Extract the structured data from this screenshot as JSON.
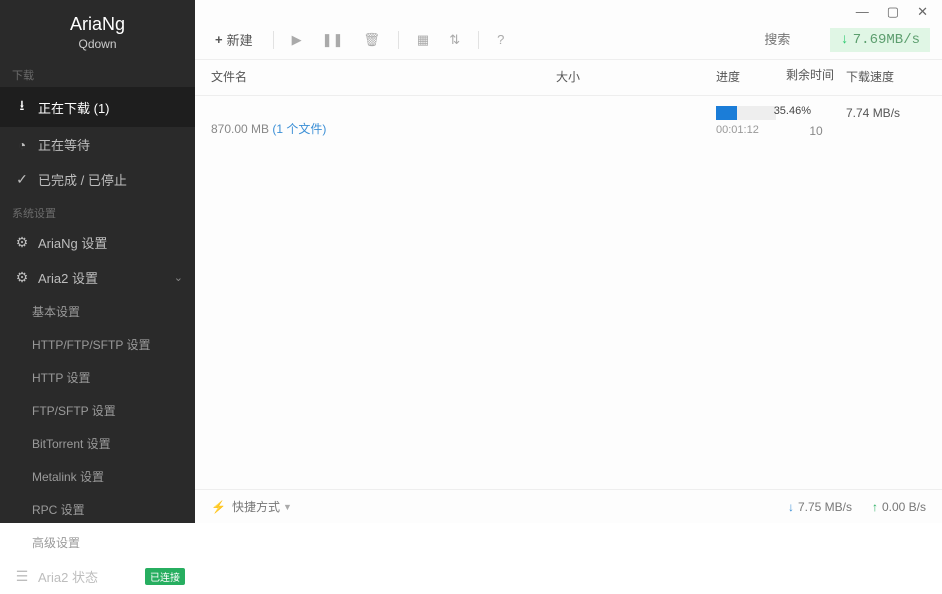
{
  "brand": {
    "title": "AriaNg",
    "subtitle": "Qdown"
  },
  "sidebar": {
    "section_downloads": "下载",
    "downloading": {
      "label": "正在下载 (1)"
    },
    "waiting": {
      "label": "正在等待"
    },
    "finished": {
      "label": "已完成 / 已停止"
    },
    "section_system": "系统设置",
    "ariang_settings": {
      "label": "AriaNg 设置"
    },
    "aria2_settings": {
      "label": "Aria2 设置"
    },
    "aria2_subs": {
      "basic": "基本设置",
      "http_ftp_sftp": "HTTP/FTP/SFTP 设置",
      "http": "HTTP 设置",
      "ftp_sftp": "FTP/SFTP 设置",
      "bittorrent": "BitTorrent 设置",
      "metalink": "Metalink 设置",
      "rpc": "RPC 设置",
      "advanced": "高级设置"
    },
    "aria2_status": {
      "label": "Aria2 状态",
      "badge": "已连接"
    }
  },
  "toolbar": {
    "new_label": "新建",
    "search_placeholder": "搜索",
    "global_speed": "7.69MB/s"
  },
  "columns": {
    "name": "文件名",
    "size": "大小",
    "progress": "进度",
    "remaining": "剩余时间",
    "speed": "下载速度"
  },
  "row": {
    "filesize": "870.00 MB ",
    "filecount": "(1 个文件)",
    "progress_pct": "35.46%",
    "progress_width": "35.46%",
    "eta": "00:01:12",
    "remaining_count": "10",
    "speed": "7.74 MB/s"
  },
  "footer": {
    "quick": "快捷方式",
    "down_speed": "7.75 MB/s",
    "up_speed": "0.00 B/s"
  }
}
